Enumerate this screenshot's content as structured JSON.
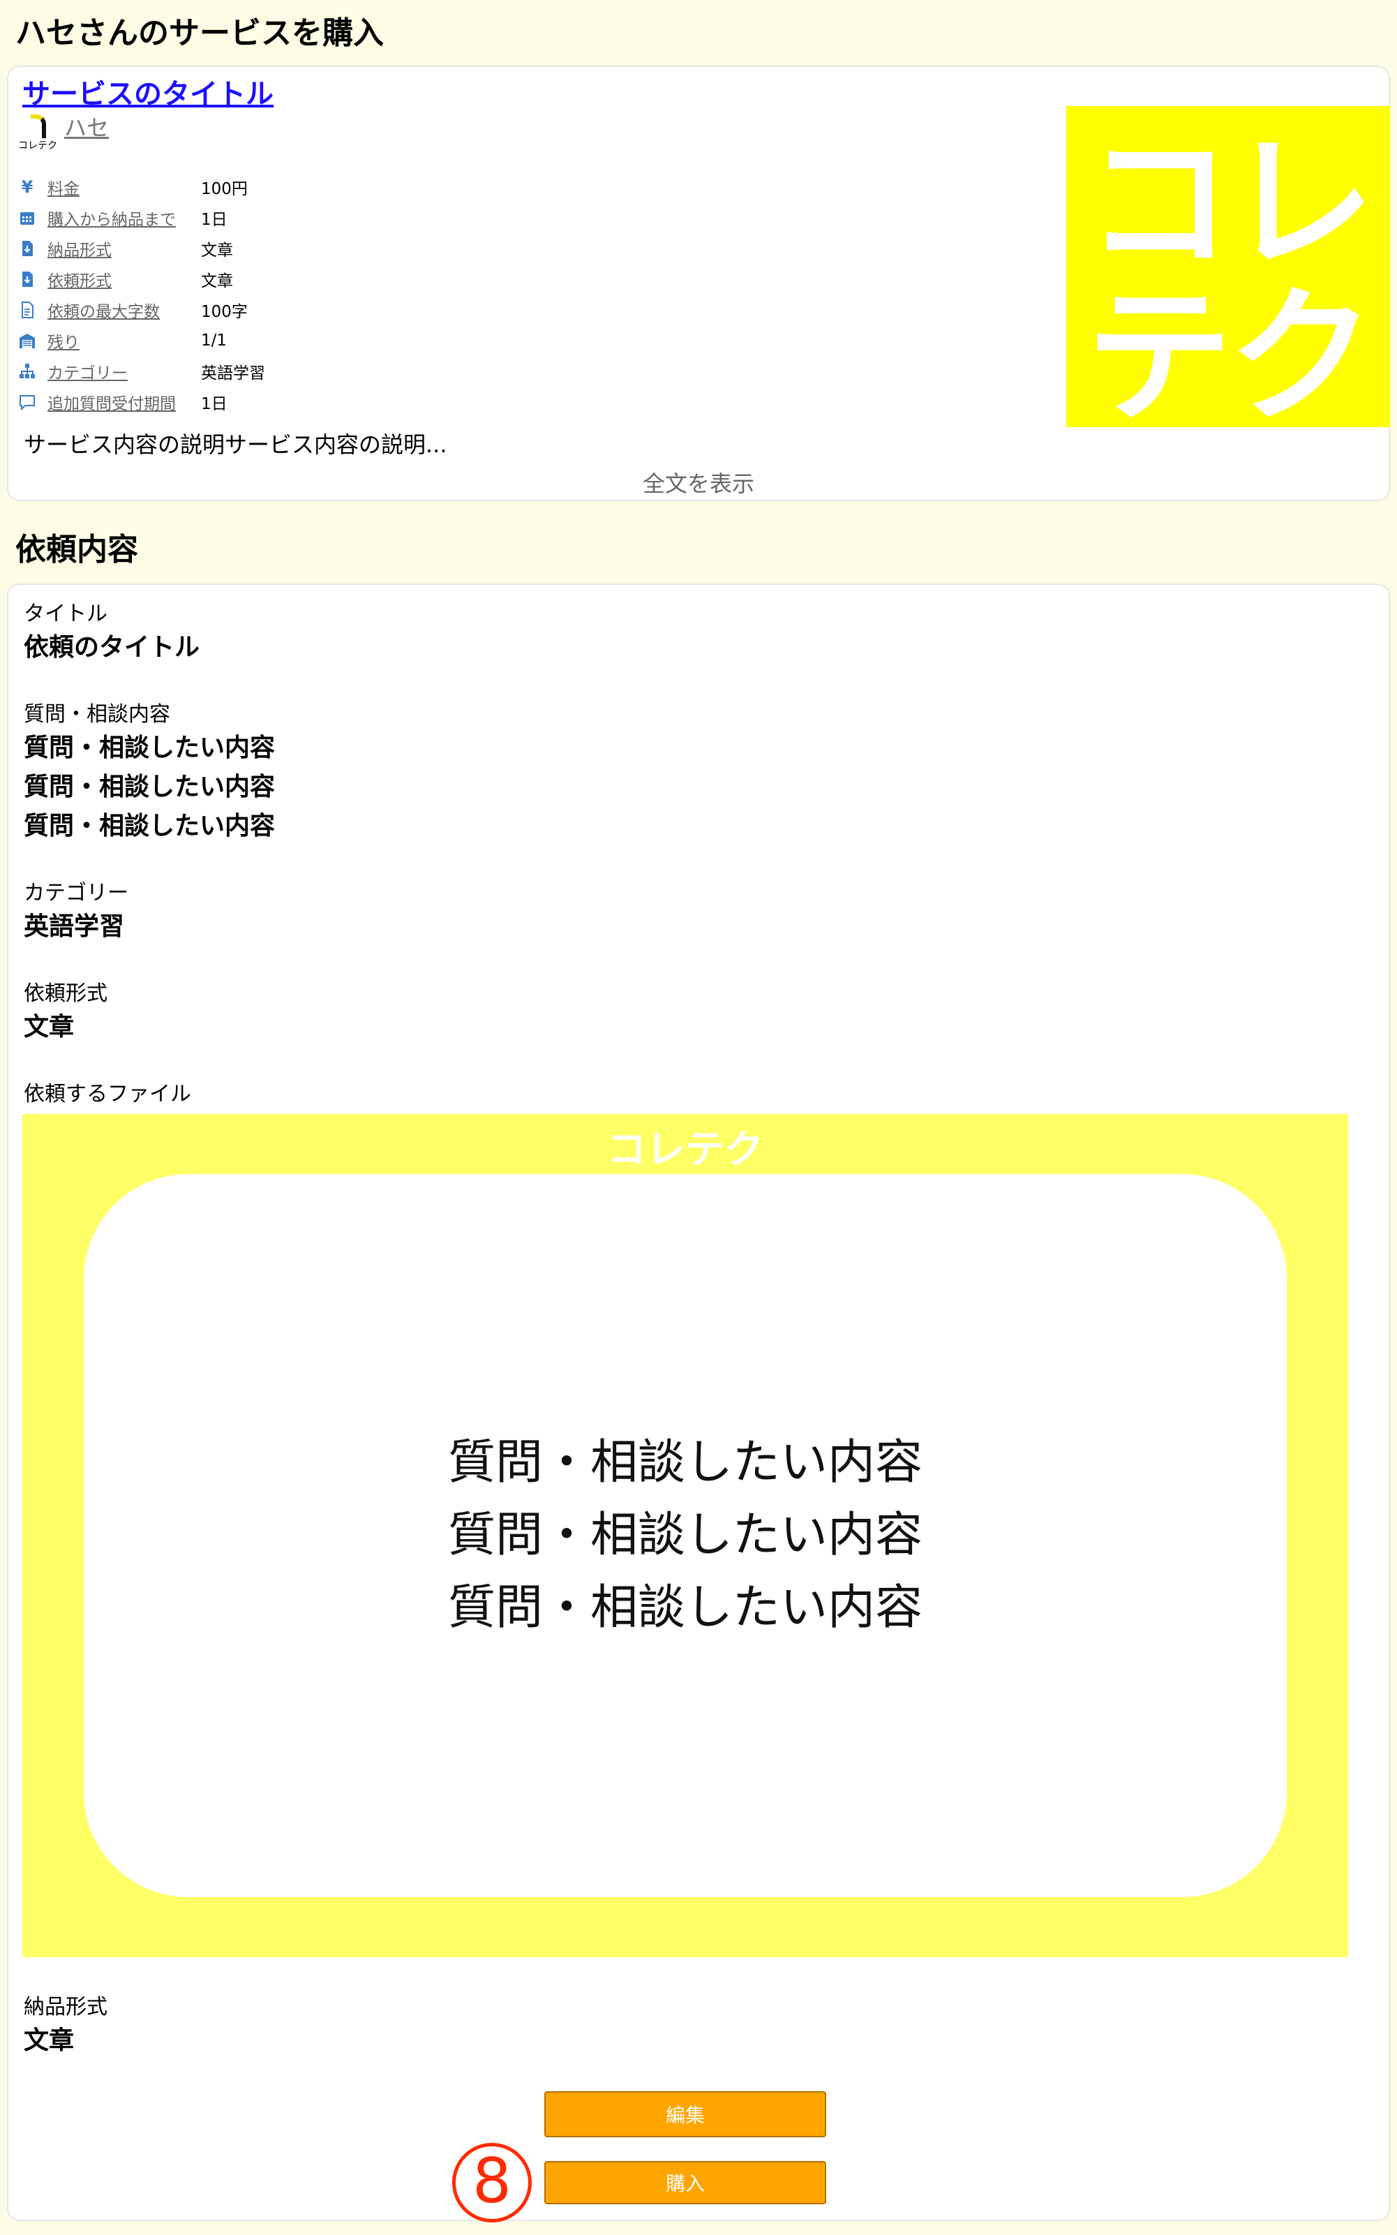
{
  "page": {
    "title": "ハセさんのサービスを購入",
    "request_heading": "依頼内容"
  },
  "service": {
    "title": "サービスのタイトル",
    "seller": {
      "logo_text": "コレテク",
      "name": "ハセ"
    },
    "specs": [
      {
        "icon": "yen-icon",
        "label": "料金",
        "value": "100円"
      },
      {
        "icon": "calendar-icon",
        "label": "購入から納品まで",
        "value": "1日"
      },
      {
        "icon": "file-download-icon",
        "label": "納品形式",
        "value": "文章"
      },
      {
        "icon": "file-download-icon",
        "label": "依頼形式",
        "value": "文章"
      },
      {
        "icon": "file-text-icon",
        "label": "依頼の最大字数",
        "value": "100字"
      },
      {
        "icon": "warehouse-icon",
        "label": "残り",
        "value": "1/1"
      },
      {
        "icon": "sitemap-icon",
        "label": "カテゴリー",
        "value": "英語学習"
      },
      {
        "icon": "comment-icon",
        "label": "追加質問受付期間",
        "value": "1日"
      }
    ],
    "thumbnail_text_line1": "コレ",
    "thumbnail_text_line2": "テク",
    "description": "サービス内容の説明サービス内容の説明...",
    "show_all_label": "全文を表示"
  },
  "request": {
    "title_label": "タイトル",
    "title_value": "依頼のタイトル",
    "content_label": "質問・相談内容",
    "content_lines": [
      "質問・相談したい内容",
      "質問・相談したい内容",
      "質問・相談したい内容"
    ],
    "category_label": "カテゴリー",
    "category_value": "英語学習",
    "request_format_label": "依頼形式",
    "request_format_value": "文章",
    "file_label": "依頼するファイル",
    "file_image": {
      "brand": "コレテク",
      "lines": [
        "質問・相談したい内容",
        "質問・相談したい内容",
        "質問・相談したい内容"
      ]
    },
    "delivery_format_label": "納品形式",
    "delivery_format_value": "文章"
  },
  "actions": {
    "edit_label": "編集",
    "buy_label": "購入",
    "step_marker": "8"
  },
  "colors": {
    "background": "#fdfde6",
    "link": "#1a0dff",
    "icon": "#3a7dc9",
    "button": "#ffa500",
    "thumbnail": "#ffff00",
    "file_image_bg": "#ffff66",
    "step_marker": "#ff2a00"
  }
}
